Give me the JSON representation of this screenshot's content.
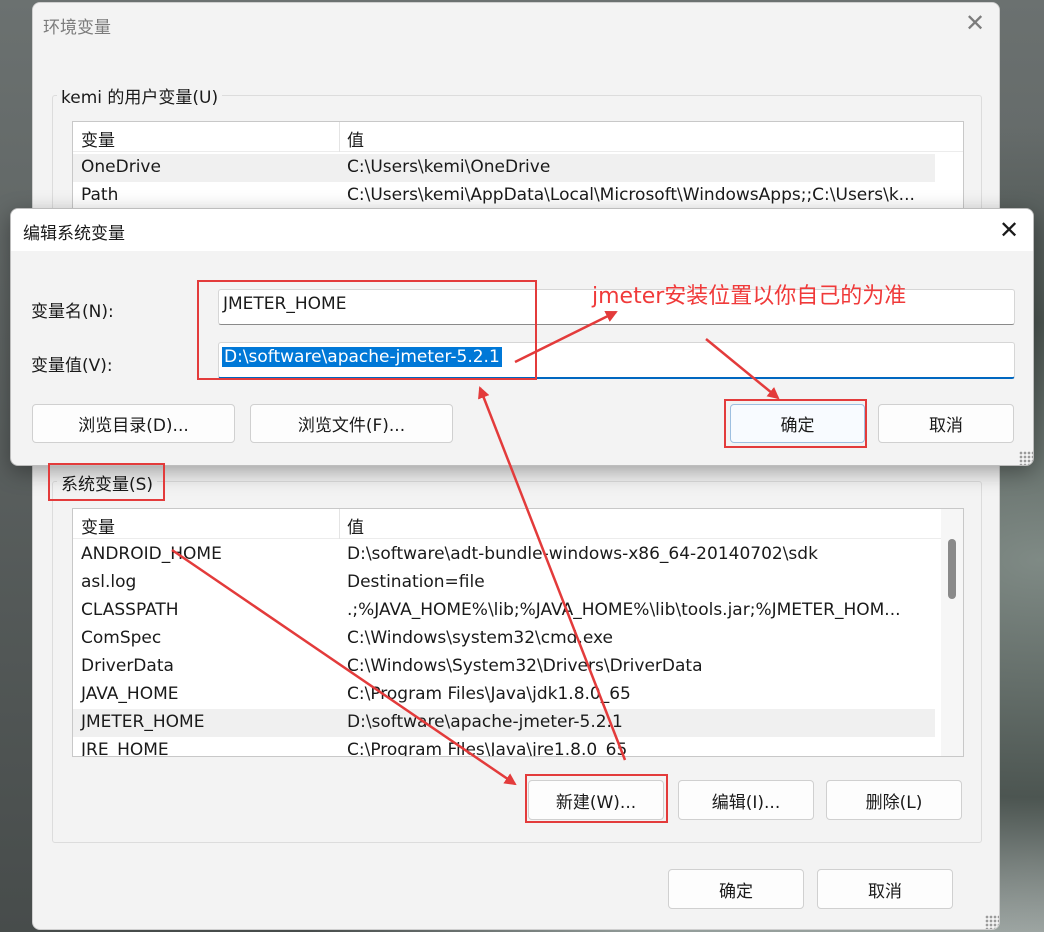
{
  "env_window": {
    "title": "环境变量",
    "user_group_label": "kemi 的用户变量(U)",
    "user_columns": [
      "变量",
      "值"
    ],
    "user_rows": [
      {
        "name": "OneDrive",
        "value": "C:\\Users\\kemi\\OneDrive"
      },
      {
        "name": "Path",
        "value": "C:\\Users\\kemi\\AppData\\Local\\Microsoft\\WindowsApps;;C:\\Users\\k..."
      }
    ],
    "system_group_label": "系统变量(S)",
    "system_columns": [
      "变量",
      "值"
    ],
    "system_rows": [
      {
        "name": "ANDROID_HOME",
        "value": "D:\\software\\adt-bundle-windows-x86_64-20140702\\sdk"
      },
      {
        "name": "asl.log",
        "value": "Destination=file"
      },
      {
        "name": "CLASSPATH",
        "value": ".;%JAVA_HOME%\\lib;%JAVA_HOME%\\lib\\tools.jar;%JMETER_HOM..."
      },
      {
        "name": "ComSpec",
        "value": "C:\\Windows\\system32\\cmd.exe"
      },
      {
        "name": "DriverData",
        "value": "C:\\Windows\\System32\\Drivers\\DriverData"
      },
      {
        "name": "JAVA_HOME",
        "value": "C:\\Program Files\\Java\\jdk1.8.0_65"
      },
      {
        "name": "JMETER_HOME",
        "value": "D:\\software\\apache-jmeter-5.2.1"
      },
      {
        "name": "JRE_HOME",
        "value": "C:\\Program Files\\Java\\jre1.8.0_65"
      }
    ],
    "selected_system_row": "JMETER_HOME",
    "system_buttons": {
      "new": "新建(W)...",
      "edit": "编辑(I)...",
      "delete": "删除(L)"
    },
    "ok": "确定",
    "cancel": "取消"
  },
  "edit_dialog": {
    "title": "编辑系统变量",
    "name_label": "变量名(N):",
    "value_label": "变量值(V):",
    "name_value": "JMETER_HOME",
    "value_value": "D:\\software\\apache-jmeter-5.2.1",
    "browse_dir": "浏览目录(D)...",
    "browse_file": "浏览文件(F)...",
    "ok": "确定",
    "cancel": "取消"
  },
  "annotation": {
    "text": "jmeter安装位置以你自己的为准",
    "color": "#f03a3a"
  },
  "icons": [
    "close-icon",
    "resize-grip-icon"
  ]
}
